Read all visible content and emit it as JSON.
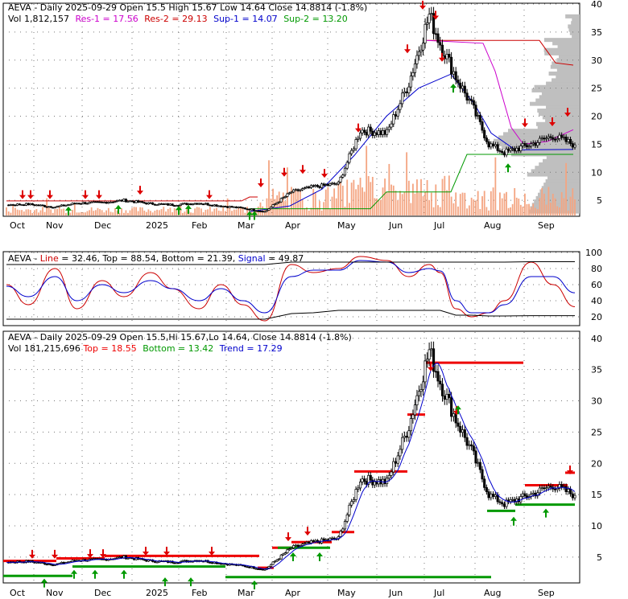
{
  "colors": {
    "up": "#000000",
    "down": "#000000",
    "res1": "#cc00cc",
    "res2": "#cc0000",
    "sup1": "#0000cc",
    "sup2": "#009900",
    "volume": "#f4a582",
    "profile": "#bfbfbf",
    "arrow_up": "#009900",
    "arrow_down": "#dd0000",
    "line": "#cc0000",
    "signal": "#0000cc",
    "band": "#000000",
    "trend": "#0000cc",
    "top": "#ee0000",
    "bottom": "#009900"
  },
  "panel1": {
    "header1_pre": "AEVA - Daily 2025-09-29 Open 15.5  High 15.67  Low 14.64  Close 14.8814 (-1.8%)",
    "header2_vol": "Vol 1,812,157",
    "header2_res1": "Res-1 = 17.56",
    "header2_res2": "Res-2 = 29.13",
    "header2_sup1": "Sup-1 = 14.07",
    "header2_sup2": "Sup-2 = 13.20"
  },
  "panel2": {
    "header_pre": "AEVA - ",
    "header_line": "Line",
    "header_line_val": " = 32.46, ",
    "header_top": "Top",
    "header_top_val": " = 88.54, ",
    "header_bottom": "Bottom",
    "header_bottom_val": " = 21.39, ",
    "header_signal": "Signal",
    "header_signal_val": " = 49.87"
  },
  "panel3": {
    "header1": "AEVA - Daily 2025-09-29 Open 15.5,Hi 15.67,Lo 14.64, Close 14.8814 (-1.8%)",
    "header2_vol": "Vol 181,215,696 ",
    "header2_top": "Top = 18.55",
    "header2_bottom": "Bottom = 13.42",
    "header2_trend": "Trend = 17.29"
  },
  "chart_data": [
    {
      "type": "candlestick",
      "title": "AEVA - Daily 2025-09-29 Open 15.5  High 15.67  Low 14.64  Close 14.8814 (-1.8%)",
      "x_labels": [
        "Oct",
        "Nov",
        "Dec",
        "2025",
        "Feb",
        "Mar",
        "Apr",
        "May",
        "Jun",
        "Jul",
        "Aug",
        "Sep"
      ],
      "y_ticks": [
        5,
        10,
        15,
        20,
        25,
        30,
        35,
        40
      ],
      "ylim": [
        2.3,
        40
      ],
      "x": [
        "2024-10-01",
        "2024-10-15",
        "2024-11-01",
        "2024-11-15",
        "2024-12-01",
        "2024-12-15",
        "2025-01-01",
        "2025-01-15",
        "2025-02-01",
        "2025-02-15",
        "2025-03-01",
        "2025-03-15",
        "2025-04-01",
        "2025-04-15",
        "2025-05-01",
        "2025-05-15",
        "2025-06-01",
        "2025-06-15",
        "2025-06-28",
        "2025-07-05",
        "2025-07-15",
        "2025-07-25",
        "2025-08-05",
        "2025-08-15",
        "2025-09-01",
        "2025-09-15",
        "2025-09-29"
      ],
      "close": [
        4.2,
        4.3,
        3.8,
        4.5,
        4.6,
        5.0,
        4.4,
        4.2,
        4.5,
        4.0,
        3.6,
        3.0,
        6.5,
        7.4,
        8.0,
        17.5,
        17.0,
        26.0,
        38.0,
        33.0,
        27.0,
        22.0,
        15.0,
        13.5,
        15.0,
        16.5,
        14.88
      ],
      "resistance_1": 17.56,
      "resistance_2": 29.13,
      "support_1": 14.07,
      "support_2": 13.2,
      "volume_label": "Vol 1,812,157"
    },
    {
      "type": "line",
      "title": "AEVA - Line = 32.46, Top = 88.54, Bottom = 21.39, Signal = 49.87",
      "y_ticks": [
        20,
        40,
        60,
        80,
        100
      ],
      "ylim": [
        10,
        100
      ],
      "series": [
        {
          "name": "Line",
          "values": [
            60,
            35,
            80,
            30,
            65,
            45,
            75,
            55,
            30,
            60,
            35,
            15,
            85,
            75,
            80,
            95,
            90,
            70,
            85,
            75,
            30,
            20,
            25,
            40,
            88,
            60,
            32.46
          ]
        },
        {
          "name": "Signal",
          "values": [
            58,
            45,
            70,
            40,
            60,
            50,
            65,
            55,
            40,
            55,
            40,
            25,
            70,
            78,
            78,
            90,
            88,
            75,
            80,
            77,
            40,
            25,
            25,
            35,
            70,
            70,
            49.87
          ]
        },
        {
          "name": "Top",
          "values": [
            85,
            85,
            85,
            85,
            85,
            85,
            85,
            85,
            85,
            85,
            85,
            85,
            88,
            88,
            88,
            88,
            88,
            88,
            88,
            88,
            88,
            88,
            88,
            88,
            88.5,
            88.5,
            88.54
          ]
        },
        {
          "name": "Bottom",
          "values": [
            17,
            17,
            17,
            17,
            17,
            17,
            17,
            17,
            17,
            17,
            17,
            17,
            24,
            25,
            28,
            28,
            28,
            28,
            28,
            28,
            22,
            22,
            21,
            21,
            21.4,
            21.4,
            21.39
          ]
        }
      ]
    },
    {
      "type": "candlestick",
      "title": "AEVA - Daily 2025-09-29 Open 15.5,Hi 15.67,Lo 14.64, Close 14.8814 (-1.8%)",
      "x_labels": [
        "Oct",
        "Nov",
        "Dec",
        "2025",
        "Feb",
        "Mar",
        "Apr",
        "May",
        "Jun",
        "Jul",
        "Aug",
        "Sep"
      ],
      "y_ticks": [
        5,
        10,
        15,
        20,
        25,
        30,
        35,
        40
      ],
      "ylim": [
        1,
        41
      ],
      "top": 18.55,
      "bottom": 13.42,
      "trend": 17.29,
      "volume_label": "Vol 181,215,696"
    }
  ]
}
